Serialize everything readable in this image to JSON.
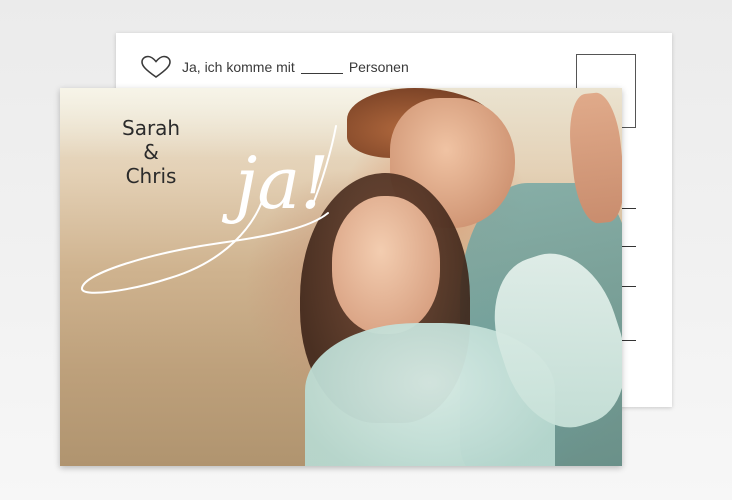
{
  "rsvp": {
    "icon": "heart-outline-icon",
    "prefix": "Ja, ich komme mit",
    "suffix": "Personen"
  },
  "front": {
    "name_1": "Sarah",
    "ampersand": "&",
    "name_2": "Chris",
    "script_word": "ja!"
  },
  "colors": {
    "card_background": "#ffffff",
    "text": "#3a3a3a",
    "script_ink": "#ffffff",
    "page_background": "#efefef"
  }
}
